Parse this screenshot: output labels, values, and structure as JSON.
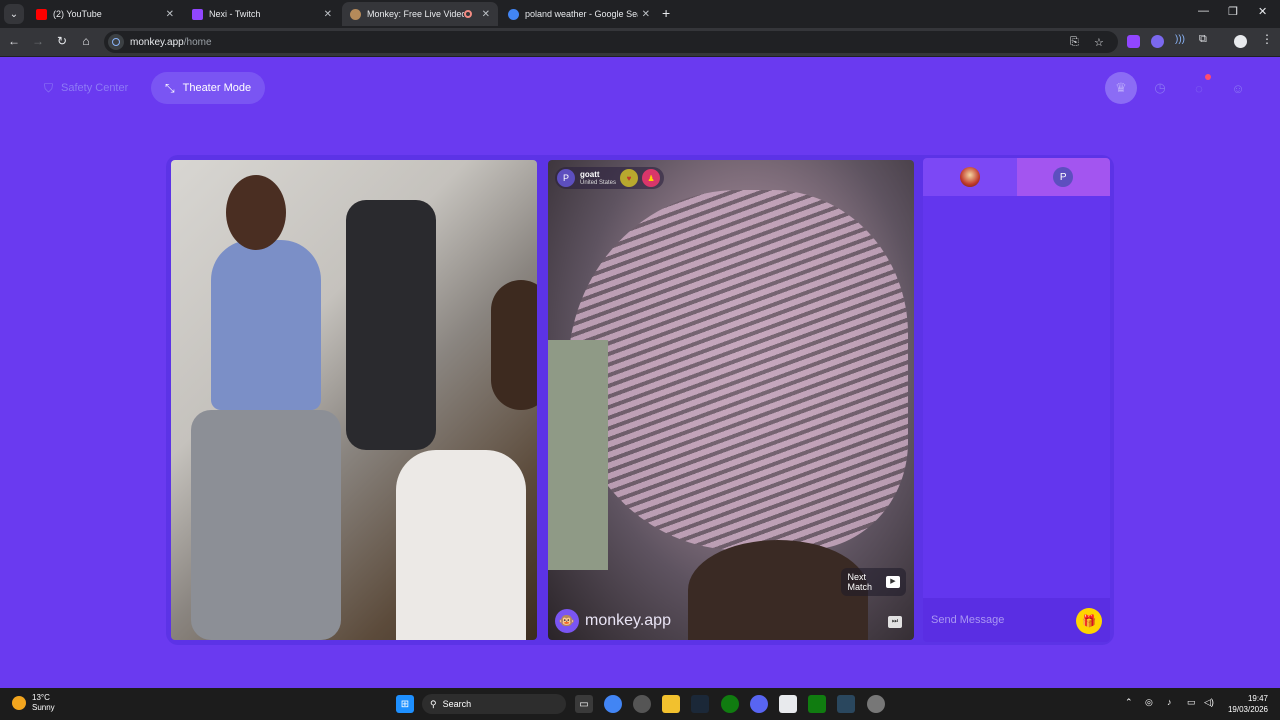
{
  "browser": {
    "tabs": [
      {
        "title": "(2) YouTube",
        "favicon_color": "#ff0000",
        "active": false
      },
      {
        "title": "Nexi - Twitch",
        "favicon_color": "#9146ff",
        "active": false
      },
      {
        "title": "Monkey: Free Live Video Ch",
        "favicon_color": "#b58a5a",
        "active": true,
        "recording": true
      },
      {
        "title": "poland weather - Google Searc",
        "favicon_color": "#4285f4",
        "active": false
      }
    ],
    "url_host": "monkey.app",
    "url_path": "/home"
  },
  "page": {
    "safety_center_label": "Safety Center",
    "theater_mode_label": "Theater Mode",
    "top_icons": [
      "crown-icon",
      "clock-icon",
      "chat-icon",
      "monkey-avatar-icon"
    ],
    "accent": "#6a3af0"
  },
  "remote_user": {
    "avatar_letter": "P",
    "name": "goatt",
    "country": "United States"
  },
  "video": {
    "brand_text": "monkey.app",
    "next_match_line1": "Next",
    "next_match_line2": "Match"
  },
  "chat": {
    "peer_avatar_letter": "P",
    "placeholder": "Send Message"
  },
  "taskbar": {
    "temperature": "13°C",
    "condition": "Sunny",
    "search_label": "Search",
    "time": "19:47",
    "date": "19/03/2026"
  }
}
